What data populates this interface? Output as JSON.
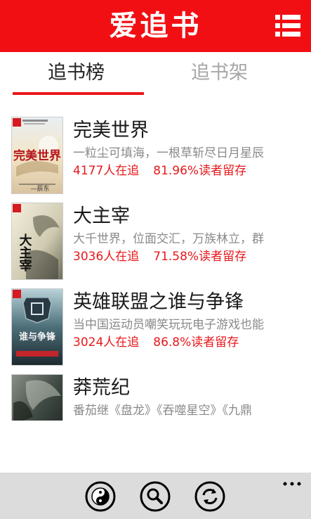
{
  "header": {
    "title": "爱追书",
    "background_color": "#f20f13",
    "menu_icon": "list-menu-icon"
  },
  "tabs": [
    {
      "label": "追书榜",
      "active": true
    },
    {
      "label": "追书架",
      "active": false
    }
  ],
  "accent_color": "#e8181c",
  "books": [
    {
      "title": "完美世界",
      "description": "一粒尘可填海，一根草斩尽日月星辰",
      "followers": "4177人在追",
      "retention": "81.96%读者留存",
      "cover_text": "完美世界",
      "cover_author": "—辰东"
    },
    {
      "title": "大主宰",
      "description": "大千世界，位面交汇，万族林立，群",
      "followers": "3036人在追",
      "retention": "71.58%读者留存",
      "cover_text": "大主宰"
    },
    {
      "title": "英雄联盟之谁与争锋",
      "description": "当中国运动员嘲笑玩玩电子游戏也能",
      "followers": "3024人在追",
      "retention": "86.8%读者留存",
      "cover_text": "谁与争锋"
    },
    {
      "title": "莽荒纪",
      "description": "番茄继《盘龙》《吞噬星空》《九鼎",
      "followers": "",
      "retention": ""
    }
  ],
  "app_bar": {
    "buttons": [
      "yin-yang-icon",
      "search-icon",
      "refresh-icon"
    ],
    "more_icon": "more-dots-icon"
  }
}
